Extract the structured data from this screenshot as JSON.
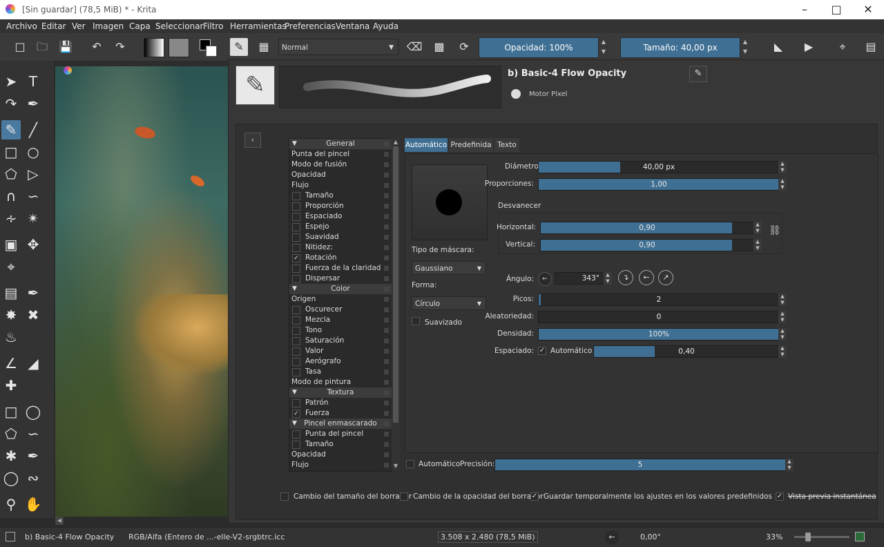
{
  "window": {
    "title": "[Sin guardar]  (78,5 MiB)  * - Krita"
  },
  "menu": [
    "Archivo",
    "Editar",
    "Ver",
    "Imagen",
    "Capa",
    "Seleccionar",
    "Filtro",
    "Herramientas",
    "Preferencias",
    "Ventana",
    "Ayuda"
  ],
  "toolbar": {
    "blend_mode": "Normal",
    "opacity_label": "Opacidad: 100%",
    "size_label": "Tamaño: 40,00 px"
  },
  "preset": {
    "name": "b) Basic-4 Flow Opacity",
    "engine": "Motor Píxel"
  },
  "options_list": [
    {
      "label": "General",
      "type": "section"
    },
    {
      "label": "Punta del pincel",
      "type": "item"
    },
    {
      "label": "Modo de fusión",
      "type": "item"
    },
    {
      "label": "Opacidad",
      "type": "item"
    },
    {
      "label": "Flujo",
      "type": "item"
    },
    {
      "label": "Tamaño",
      "type": "check",
      "checked": false
    },
    {
      "label": "Proporción",
      "type": "check",
      "checked": false
    },
    {
      "label": "Espaciado",
      "type": "check",
      "checked": false
    },
    {
      "label": "Espejo",
      "type": "check",
      "checked": false
    },
    {
      "label": "Suavidad",
      "type": "check",
      "checked": false
    },
    {
      "label": "Nitidez:",
      "type": "check",
      "checked": false
    },
    {
      "label": "Rotación",
      "type": "check",
      "checked": true
    },
    {
      "label": "Fuerza de la claridad",
      "type": "check",
      "checked": false
    },
    {
      "label": "Dispersar",
      "type": "check",
      "checked": false
    },
    {
      "label": "Color",
      "type": "section"
    },
    {
      "label": "Origen",
      "type": "item"
    },
    {
      "label": "Oscurecer",
      "type": "check",
      "checked": false
    },
    {
      "label": "Mezcla",
      "type": "check",
      "checked": false
    },
    {
      "label": "Tono",
      "type": "check",
      "checked": false
    },
    {
      "label": "Saturación",
      "type": "check",
      "checked": false
    },
    {
      "label": "Valor",
      "type": "check",
      "checked": false
    },
    {
      "label": "Aerógrafo",
      "type": "check",
      "checked": false
    },
    {
      "label": "Tasa",
      "type": "check",
      "checked": false
    },
    {
      "label": "Modo de pintura",
      "type": "item"
    },
    {
      "label": "Textura",
      "type": "section"
    },
    {
      "label": "Patrón",
      "type": "check",
      "checked": false
    },
    {
      "label": "Fuerza",
      "type": "check",
      "checked": true
    },
    {
      "label": "Pincel enmascarado",
      "type": "check-section",
      "checked": false
    },
    {
      "label": "Punta del pincel",
      "type": "check",
      "checked": false
    },
    {
      "label": "Tamaño",
      "type": "check",
      "checked": false
    },
    {
      "label": "Opacidad",
      "type": "item"
    },
    {
      "label": "Flujo",
      "type": "item"
    }
  ],
  "tabs": [
    "Automático",
    "Predefinida",
    "Texto"
  ],
  "tip": {
    "diameter_label": "Diámetro:",
    "diameter_value": "40,00 px",
    "diameter_fraction": 0.24,
    "ratio_label": "Proporciones:",
    "ratio_value": "1,00",
    "ratio_fraction": 1.0,
    "fade_label": "Desvanecer",
    "horizontal_label": "Horizontal:",
    "horizontal_value": "0,90",
    "horizontal_fraction": 0.9,
    "vertical_label": "Vertical:",
    "vertical_value": "0,90",
    "vertical_fraction": 0.9,
    "angle_label": "Ángulo:",
    "angle_value": "343°",
    "spikes_label": "Picos:",
    "spikes_value": "2",
    "random_label": "Aleatoriedad:",
    "random_value": "0",
    "density_label": "Densidad:",
    "density_value": "100%",
    "density_fraction": 1.0,
    "spacing_label": "Espaciado:",
    "spacing_auto_label": "Automático",
    "spacing_value": "0,40",
    "spacing_fraction": 0.33,
    "mask_type_label": "Tipo de máscara:",
    "mask_type_value": "Gaussiano",
    "shape_label": "Forma:",
    "shape_value": "Círculo",
    "antialias_label": "Suavizado",
    "precision_auto_label": "Automático",
    "precision_label": "Precisión:",
    "precision_value": "5"
  },
  "footer": {
    "eraser_size": "Cambio del tamaño del borrador",
    "eraser_opacity": "Cambio de la opacidad del borrador",
    "temp_save": "Guardar temporalmente los ajustes en los valores predefinidos",
    "instant_preview": "Vista previa instantánea"
  },
  "status": {
    "brush": "b) Basic-4 Flow Opacity",
    "colorspace": "RGB/Alfa (Entero de ...-elle-V2-srgbtrc.icc",
    "dimensions": "3.508 x 2.480 (78,5 MiB)",
    "rotation": "0,00°",
    "zoom": "33%"
  },
  "colors": {
    "accent": "#3f6f93",
    "panel": "#373737",
    "dark": "#2a2a2a"
  }
}
